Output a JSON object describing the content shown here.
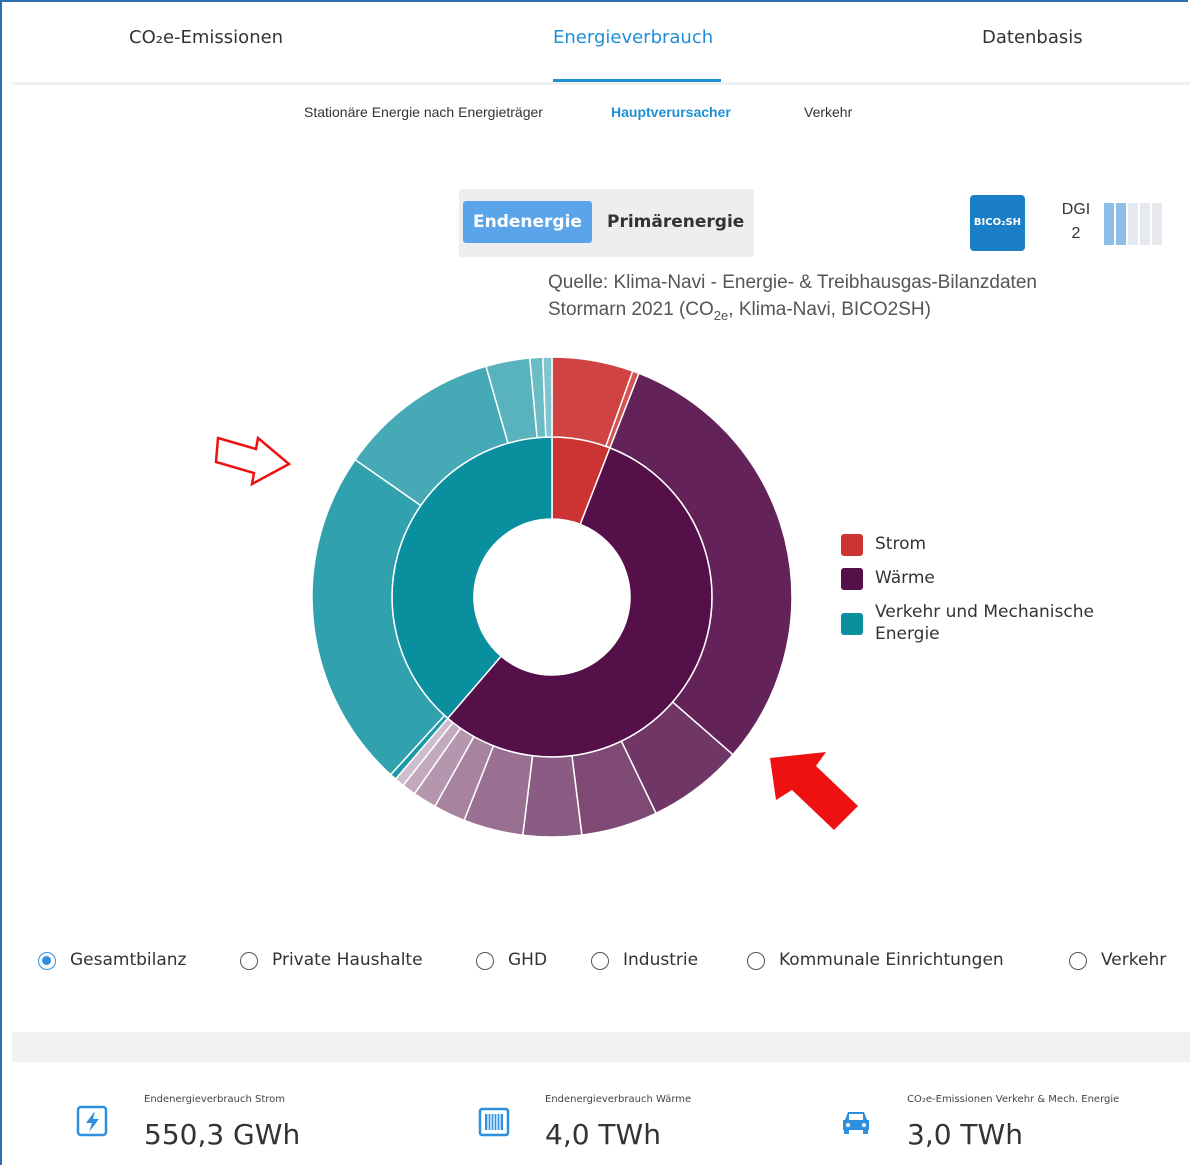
{
  "tabs": [
    {
      "label": "CO₂e-Emissionen",
      "active": false
    },
    {
      "label": "Energieverbrauch",
      "active": true
    },
    {
      "label": "Datenbasis",
      "active": false
    }
  ],
  "subnav": {
    "item1": "Stationäre Energie nach Energieträger",
    "item2": "Hauptverursacher",
    "item3": "Verkehr"
  },
  "toggle": {
    "option1": "Endenergie",
    "option2": "Primärenergie"
  },
  "badge": {
    "text": "BICO₂SH"
  },
  "dgi": {
    "label": "DGI",
    "value": "2"
  },
  "source": {
    "line1": "Quelle: Klima-Navi -  Energie- & Treibhausgas-Bilanzdaten",
    "line2_prefix": "Stormarn 2021 (CO",
    "line2_sub": "2e",
    "line2_suffix": ", Klima-Navi, BICO2SH)"
  },
  "colors": {
    "accent": "#1e8fd6",
    "strom": "#cc3333",
    "waerme": "#551049",
    "verkehr": "#0a8f9f",
    "arrow": "#ee1111"
  },
  "chart_data": {
    "type": "sunburst",
    "inner_ring": [
      {
        "name": "Strom",
        "value": 5.9
      },
      {
        "name": "Wärme",
        "value": 55.4
      },
      {
        "name": "Verkehr und Mechanische Energie",
        "value": 38.7
      }
    ],
    "outer_ring": [
      {
        "parent": "Strom",
        "values": [
          6.3,
          0.5
        ]
      },
      {
        "parent": "Wärme",
        "values": [
          32.6,
          6.9,
          5.5,
          4.2,
          4.3,
          2.3,
          1.7,
          1.0,
          0.7
        ]
      },
      {
        "parent": "Verkehr und Mechanische Energie",
        "values": [
          0.5,
          26.4,
          12.5,
          3.4,
          1.0,
          0.7
        ]
      }
    ]
  },
  "legend": [
    {
      "label": "Strom",
      "color": "#cc3333"
    },
    {
      "label": "Wärme",
      "color": "#551049"
    },
    {
      "label": "Verkehr und Mechanische Energie",
      "color": "#0a8f9f"
    }
  ],
  "radios": [
    {
      "label": "Gesamtbilanz",
      "checked": true
    },
    {
      "label": "Private Haushalte",
      "checked": false
    },
    {
      "label": "GHD",
      "checked": false
    },
    {
      "label": "Industrie",
      "checked": false
    },
    {
      "label": "Kommunale Einrichtungen",
      "checked": false
    },
    {
      "label": "Verkehr",
      "checked": false
    }
  ],
  "kpis": [
    {
      "caption": "Endenergieverbrauch Strom",
      "value": "550,3 GWh",
      "icon": "lightning-icon"
    },
    {
      "caption": "Endenergieverbrauch Wärme",
      "value": "4,0 TWh",
      "icon": "radiator-icon"
    },
    {
      "caption": "CO₂e-Emissionen Verkehr & Mech. Energie",
      "value": "3,0 TWh",
      "icon": "car-icon"
    }
  ]
}
